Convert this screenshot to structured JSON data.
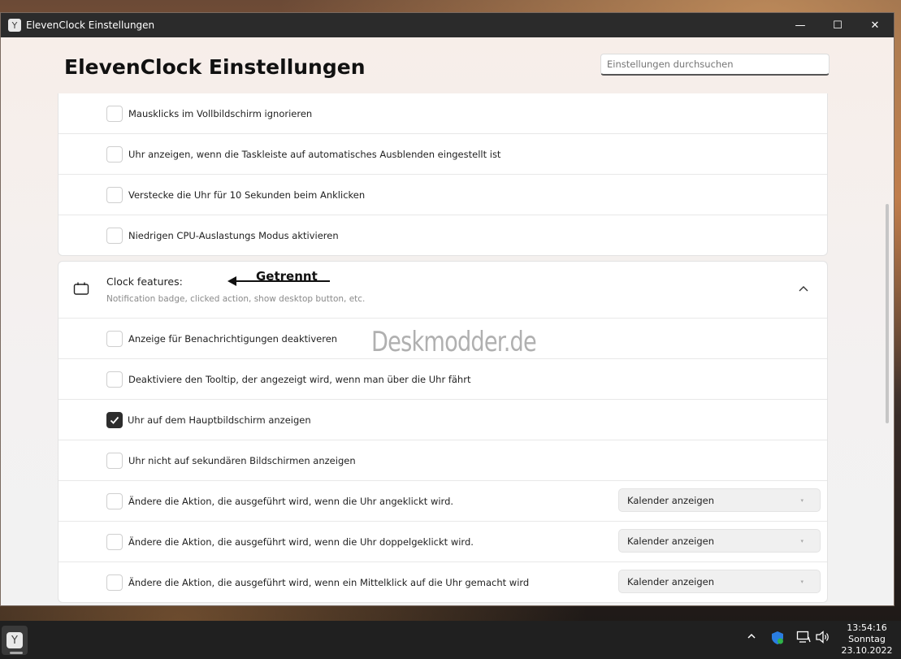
{
  "window": {
    "title": "ElevenClock Einstellungen",
    "controls": {
      "minimize": "—",
      "maximize": "☐",
      "close": "✕"
    }
  },
  "page": {
    "title": "ElevenClock Einstellungen",
    "search_placeholder": "Einstellungen durchsuchen"
  },
  "previous_section": {
    "items": [
      {
        "label": "Mausklicks im Vollbildschirm ignorieren",
        "checked": false
      },
      {
        "label": "Uhr anzeigen, wenn die Taskleiste auf automatisches Ausblenden eingestellt ist",
        "checked": false
      },
      {
        "label": "Verstecke die Uhr für 10 Sekunden beim Anklicken",
        "checked": false
      },
      {
        "label": "Niedrigen CPU-Auslastungs Modus aktivieren",
        "checked": false
      }
    ]
  },
  "clock_features": {
    "title": "Clock features:",
    "subtitle": "Notification badge, clicked action, show desktop button, etc.",
    "annotation": "Getrennt",
    "items": [
      {
        "label": "Anzeige für Benachrichtigungen deaktiveren",
        "checked": false
      },
      {
        "label": "Deaktiviere den Tooltip, der angezeigt wird, wenn man über die Uhr fährt",
        "checked": false
      },
      {
        "label": "Uhr auf dem Hauptbildschirm anzeigen",
        "checked": true
      },
      {
        "label": "Uhr nicht auf sekundären Bildschirmen anzeigen",
        "checked": false
      },
      {
        "label": "Ändere die Aktion, die ausgeführt wird, wenn die Uhr angeklickt wird.",
        "checked": false,
        "dropdown": "Kalender anzeigen"
      },
      {
        "label": "Ändere die Aktion, die ausgeführt wird, wenn die Uhr doppelgeklickt wird.",
        "checked": false,
        "dropdown": "Kalender anzeigen"
      },
      {
        "label": "Ändere die Aktion, die ausgeführt wird, wenn ein Mittelklick auf die Uhr gemacht wird",
        "checked": false,
        "dropdown": "Kalender anzeigen"
      }
    ]
  },
  "watermark": "Deskmodder.de",
  "taskbar": {
    "clock_time": "13:54:16",
    "clock_day": "Sonntag",
    "clock_date": "23.10.2022"
  }
}
